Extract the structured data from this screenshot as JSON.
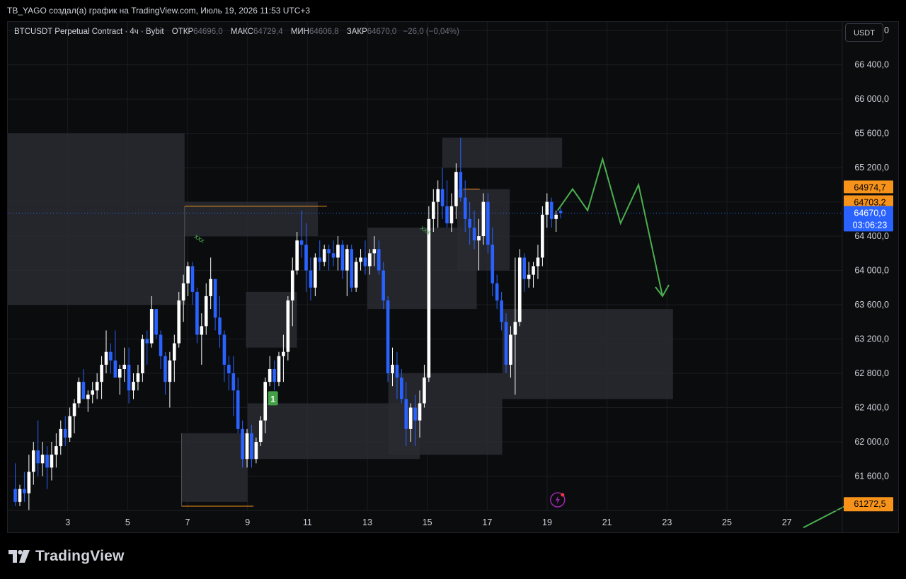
{
  "header": {
    "attribution": "TB_YAGO создал(а) график на TradingView.com, Июль 19, 2026 11:53 UTC+3"
  },
  "legend": {
    "symbol": "BTCUSDT Perpetual Contract · 4ч · Bybit",
    "open_label": "ОТКР",
    "open": "64696,0",
    "high_label": "МАКС",
    "high": "64729,4",
    "low_label": "МИН",
    "low": "64606,8",
    "close_label": "ЗАКР",
    "close": "64670,0",
    "change": "−26,0 (−0,04%)"
  },
  "currency_button": "USDT",
  "footer": {
    "brand": "TradingView"
  },
  "colors": {
    "up": "#ffffff",
    "down": "#2962ff",
    "zone": "#2a2b31",
    "arrow": "#4caf50",
    "orange": "#f7931a",
    "blue_tag": "#2962ff",
    "grid": "#1a1c22"
  },
  "chart_data": {
    "type": "candlestick",
    "symbol": "BTCUSDT",
    "timeframe": "4ч",
    "y_ticks": [
      "66 800,0",
      "66 400,0",
      "66 000,0",
      "65 600,0",
      "65 200,0",
      "64 800,0",
      "64 400,0",
      "64 000,0",
      "63 600,0",
      "63 200,0",
      "62 800,0",
      "62 400,0",
      "62 000,0",
      "61 600,0"
    ],
    "y_tick_values": [
      66800,
      66400,
      66000,
      65600,
      65200,
      64800,
      64400,
      64000,
      63600,
      63200,
      62800,
      62400,
      62000,
      61600
    ],
    "x_ticks": [
      "3",
      "5",
      "7",
      "9",
      "11",
      "13",
      "15",
      "17",
      "19",
      "21",
      "23",
      "25",
      "27"
    ],
    "x_tick_values": [
      3,
      5,
      7,
      9,
      11,
      13,
      15,
      17,
      19,
      21,
      23,
      25,
      27
    ],
    "x_range": [
      1.0,
      28.85
    ],
    "y_range": [
      61200,
      66900
    ],
    "price_tags": [
      {
        "text": "64974,7",
        "value": 64974.7,
        "color": "orange"
      },
      {
        "text": "64703,2",
        "value": 64703.2,
        "color": "orange"
      },
      {
        "text": "64670,0",
        "value": 64670,
        "color": "blue"
      },
      {
        "text": "03:06:23",
        "value": null,
        "color": "blue"
      },
      {
        "text": "61272,5",
        "value": 61272.5,
        "color": "orange"
      }
    ],
    "candles": [
      [
        61450,
        61750,
        61250,
        61300
      ],
      [
        61300,
        61500,
        61250,
        61450
      ],
      [
        61450,
        61650,
        61300,
        61400
      ],
      [
        61400,
        61850,
        61200,
        61650
      ],
      [
        61650,
        62000,
        61500,
        61900
      ],
      [
        61900,
        62250,
        61600,
        61750
      ],
      [
        61750,
        62000,
        61600,
        61850
      ],
      [
        61850,
        61950,
        61450,
        61700
      ],
      [
        61700,
        62000,
        61550,
        61850
      ],
      [
        61850,
        62100,
        61700,
        61950
      ],
      [
        61950,
        62250,
        61850,
        62150
      ],
      [
        62150,
        62300,
        61950,
        62050
      ],
      [
        62050,
        62400,
        62000,
        62300
      ],
      [
        62300,
        62500,
        62100,
        62450
      ],
      [
        62450,
        62750,
        62400,
        62700
      ],
      [
        62700,
        62850,
        62550,
        62500
      ],
      [
        62500,
        62600,
        62350,
        62550
      ],
      [
        62550,
        62700,
        62450,
        62600
      ],
      [
        62600,
        62800,
        62500,
        62700
      ],
      [
        62700,
        63000,
        62500,
        62900
      ],
      [
        62900,
        63300,
        62800,
        63050
      ],
      [
        63050,
        63150,
        62800,
        62950
      ],
      [
        62950,
        63300,
        62750,
        62750
      ],
      [
        62750,
        62900,
        62550,
        62850
      ],
      [
        62850,
        63100,
        62700,
        62900
      ],
      [
        62900,
        63100,
        62450,
        62600
      ],
      [
        62600,
        62800,
        62500,
        62700
      ],
      [
        62700,
        62900,
        62600,
        62800
      ],
      [
        62800,
        63250,
        62700,
        63200
      ],
      [
        63200,
        63300,
        62900,
        63150
      ],
      [
        63150,
        63700,
        63100,
        63550
      ],
      [
        63550,
        63550,
        63200,
        63250
      ],
      [
        63250,
        63300,
        62850,
        63000
      ],
      [
        63000,
        63050,
        62550,
        62700
      ],
      [
        62700,
        63050,
        62400,
        62950
      ],
      [
        62950,
        63250,
        62700,
        63150
      ],
      [
        63150,
        63750,
        63100,
        63650
      ],
      [
        63650,
        63950,
        63400,
        63850
      ],
      [
        63850,
        64100,
        63700,
        64050
      ],
      [
        64050,
        64100,
        63600,
        63750
      ],
      [
        63750,
        63800,
        63150,
        63250
      ],
      [
        63250,
        63500,
        62900,
        63350
      ],
      [
        63350,
        63850,
        63250,
        63700
      ],
      [
        63700,
        64150,
        63550,
        63900
      ],
      [
        63900,
        63900,
        63300,
        63450
      ],
      [
        63450,
        63700,
        63100,
        63250
      ],
      [
        63250,
        63300,
        62700,
        62900
      ],
      [
        62900,
        63000,
        62600,
        62800
      ],
      [
        62800,
        63000,
        62300,
        62600
      ],
      [
        62600,
        62750,
        62100,
        62150
      ],
      [
        62150,
        62250,
        61700,
        61800
      ],
      [
        61800,
        62150,
        61700,
        62100
      ],
      [
        62100,
        62200,
        61700,
        61800
      ],
      [
        61800,
        62050,
        61750,
        62000
      ],
      [
        62000,
        62300,
        61950,
        62250
      ],
      [
        62250,
        62750,
        62100,
        62700
      ],
      [
        62700,
        63000,
        62650,
        62850
      ],
      [
        62850,
        62950,
        62600,
        62700
      ],
      [
        62700,
        63050,
        62650,
        63000
      ],
      [
        63000,
        63250,
        62700,
        63050
      ],
      [
        63050,
        63700,
        62950,
        63650
      ],
      [
        63650,
        64150,
        63350,
        64000
      ],
      [
        64000,
        64450,
        63950,
        64350
      ],
      [
        64350,
        64700,
        64150,
        64300
      ],
      [
        64300,
        64550,
        63750,
        64000
      ],
      [
        64000,
        64150,
        63650,
        63800
      ],
      [
        63800,
        64200,
        63700,
        64150
      ],
      [
        64150,
        64350,
        64000,
        64100
      ],
      [
        64100,
        64300,
        64050,
        64250
      ],
      [
        64250,
        64300,
        64000,
        64200
      ],
      [
        64200,
        64350,
        64050,
        64150
      ],
      [
        64150,
        64400,
        64000,
        64300
      ],
      [
        64300,
        64350,
        63900,
        64000
      ],
      [
        64000,
        64300,
        63700,
        64250
      ],
      [
        64250,
        64300,
        63750,
        63800
      ],
      [
        63800,
        64150,
        63750,
        64100
      ],
      [
        64100,
        64250,
        64000,
        64150
      ],
      [
        64150,
        64350,
        63950,
        64050
      ],
      [
        64050,
        64250,
        63950,
        64200
      ],
      [
        64200,
        64400,
        64050,
        64250
      ],
      [
        64250,
        64350,
        63950,
        64000
      ],
      [
        64000,
        64100,
        63550,
        63650
      ],
      [
        63650,
        63700,
        62700,
        62800
      ],
      [
        62800,
        63100,
        62650,
        62900
      ],
      [
        62900,
        63050,
        62500,
        62750
      ],
      [
        62750,
        62850,
        62450,
        62500
      ],
      [
        62500,
        62700,
        61950,
        62150
      ],
      [
        62150,
        62450,
        62000,
        62400
      ],
      [
        62400,
        62550,
        61950,
        62250
      ],
      [
        62250,
        62600,
        62050,
        62450
      ],
      [
        62450,
        62900,
        62400,
        62750
      ],
      [
        62750,
        64750,
        62700,
        64600
      ],
      [
        64600,
        64950,
        64450,
        64800
      ],
      [
        64800,
        65050,
        64500,
        64950
      ],
      [
        64950,
        65200,
        64600,
        64750
      ],
      [
        64750,
        65050,
        64500,
        64550
      ],
      [
        64550,
        64900,
        64450,
        64750
      ],
      [
        64750,
        65250,
        64600,
        65150
      ],
      [
        65150,
        65550,
        64800,
        64850
      ],
      [
        64850,
        65050,
        64450,
        64600
      ],
      [
        64600,
        64800,
        64300,
        64500
      ],
      [
        64500,
        64700,
        64250,
        64350
      ],
      [
        64350,
        64600,
        64000,
        64400
      ],
      [
        64400,
        64900,
        64300,
        64800
      ],
      [
        64800,
        64900,
        64200,
        64300
      ],
      [
        64300,
        64500,
        63700,
        63850
      ],
      [
        63850,
        63950,
        63550,
        63650
      ],
      [
        63650,
        63750,
        63300,
        63400
      ],
      [
        63400,
        63500,
        62800,
        62900
      ],
      [
        62900,
        63350,
        62750,
        63250
      ],
      [
        63250,
        64150,
        62550,
        63400
      ],
      [
        63400,
        64250,
        63350,
        64150
      ],
      [
        64150,
        64200,
        63750,
        63900
      ],
      [
        63900,
        64100,
        63800,
        63950
      ],
      [
        63950,
        64100,
        63800,
        64050
      ],
      [
        64050,
        64300,
        63900,
        64150
      ],
      [
        64150,
        64750,
        64050,
        64650
      ],
      [
        64650,
        64900,
        64500,
        64800
      ],
      [
        64800,
        64850,
        64500,
        64600
      ],
      [
        64600,
        64700,
        64450,
        64650
      ],
      [
        64696,
        64729.4,
        64606.8,
        64670
      ]
    ],
    "zones": [
      {
        "d0": 1.0,
        "d1": 6.9,
        "p0": 63600,
        "p1": 65600
      },
      {
        "d0": 6.9,
        "d1": 11.35,
        "p0": 64400,
        "p1": 64800
      },
      {
        "d0": 8.95,
        "d1": 10.65,
        "p0": 63100,
        "p1": 63750
      },
      {
        "d0": 6.8,
        "d1": 9.0,
        "p0": 61300,
        "p1": 62100
      },
      {
        "d0": 9.0,
        "d1": 14.75,
        "p0": 61800,
        "p1": 62450
      },
      {
        "d0": 13.0,
        "d1": 16.65,
        "p0": 63550,
        "p1": 64500
      },
      {
        "d0": 15.5,
        "d1": 19.5,
        "p0": 65200,
        "p1": 65550
      },
      {
        "d0": 16.0,
        "d1": 17.75,
        "p0": 64000,
        "p1": 64950
      },
      {
        "d0": 13.7,
        "d1": 17.5,
        "p0": 61850,
        "p1": 62800
      },
      {
        "d0": 17.5,
        "d1": 23.2,
        "p0": 62500,
        "p1": 63550
      }
    ],
    "orange_lines": [
      {
        "d0": 6.9,
        "d1": 11.65,
        "p": 64750
      },
      {
        "d0": 6.8,
        "d1": 9.2,
        "p": 61250
      },
      {
        "d0": 16.2,
        "d1": 16.75,
        "p": 64950
      }
    ],
    "current_price_line": 64670,
    "projection_arrow": [
      [
        19.35,
        64700
      ],
      [
        19.85,
        64950
      ],
      [
        20.35,
        64700
      ],
      [
        20.85,
        65300
      ],
      [
        21.45,
        64550
      ],
      [
        22.05,
        65000
      ],
      [
        22.85,
        63700
      ]
    ],
    "second_arrow_start": [
      27.55,
      61000
    ],
    "markers": [
      {
        "text": "xxx",
        "d": 7.35,
        "p": 64350
      },
      {
        "text": "xxx",
        "d": 14.9,
        "p": 64450
      },
      {
        "text": "1",
        "d": 9.85,
        "p": 62500
      }
    ]
  }
}
